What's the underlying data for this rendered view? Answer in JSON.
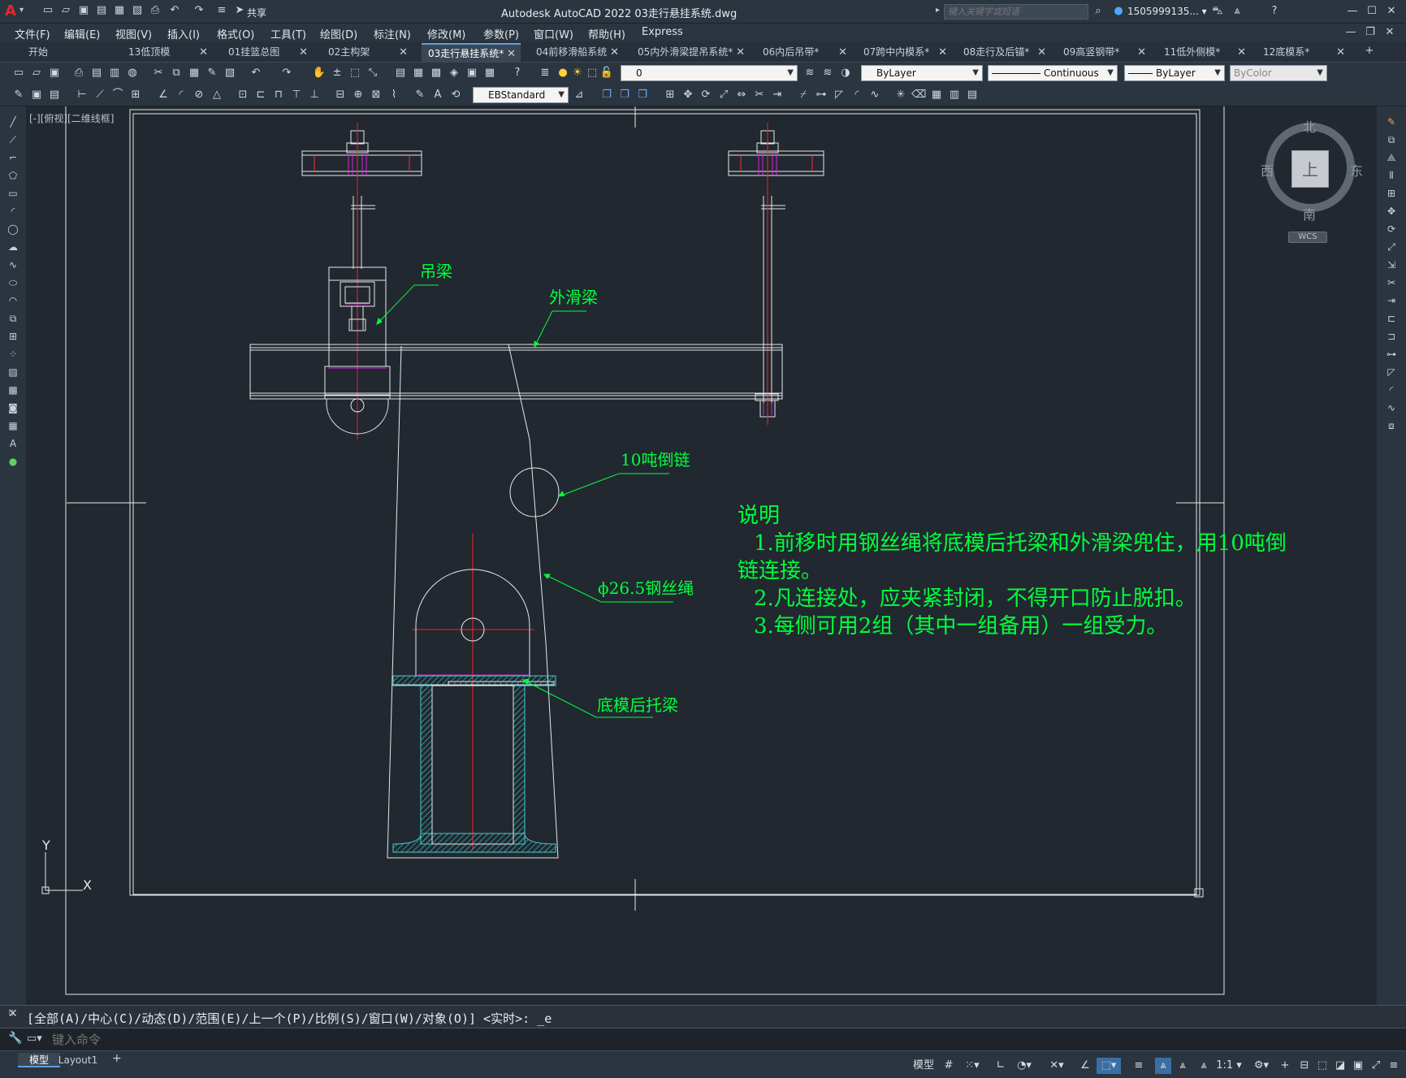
{
  "app": {
    "title": "Autodesk AutoCAD 2022    03走行悬挂系统.dwg",
    "share_label": "共享",
    "search_placeholder": "键入关键字或短语",
    "user": "1505999135... ▾",
    "logo": "A"
  },
  "menu": [
    "文件(F)",
    "编辑(E)",
    "视图(V)",
    "插入(I)",
    "格式(O)",
    "工具(T)",
    "绘图(D)",
    "标注(N)",
    "修改(M)",
    "参数(P)",
    "窗口(W)",
    "帮助(H)",
    "Express"
  ],
  "tabs": [
    {
      "label": "开始",
      "active": false
    },
    {
      "label": "13低顶模",
      "active": false
    },
    {
      "label": "01挂篮总图",
      "active": false
    },
    {
      "label": "02主构架",
      "active": false
    },
    {
      "label": "03走行悬挂系统*",
      "active": true
    },
    {
      "label": "04前移滑船系统",
      "active": false
    },
    {
      "label": "05内外滑梁提吊系统*",
      "active": false
    },
    {
      "label": "06内后吊带*",
      "active": false
    },
    {
      "label": "07跨中内模系*",
      "active": false
    },
    {
      "label": "08走行及后锚*",
      "active": false
    },
    {
      "label": "09高竖钢带*",
      "active": false
    },
    {
      "label": "11低外侧模*",
      "active": false
    },
    {
      "label": "12底模系*",
      "active": false
    }
  ],
  "properties": {
    "layer": "0",
    "color": "ByLayer",
    "linetype": "Continuous",
    "lineweight": "ByLayer",
    "plotstyle": "ByColor",
    "dimstyle": "EBStandard"
  },
  "viewport_label": "[-][俯视][二维线框]",
  "viewcube": {
    "north": "北",
    "south": "南",
    "east": "东",
    "west": "西",
    "face": "上",
    "wcs": "WCS"
  },
  "ucs": {
    "x": "X",
    "y": "Y"
  },
  "drawing": {
    "labels": {
      "hanger_beam": "吊梁",
      "outer_slide_beam": "外滑梁",
      "chain_hoist": "10吨倒链",
      "wire_rope": "ϕ26.5钢丝绳",
      "bottom_beam": "底模后托梁"
    },
    "notes": {
      "title": "说明",
      "line1a": "1.前移时用钢丝绳将底模后托梁和外滑梁兜住，用10吨倒",
      "line1b": "链连接。",
      "line2": "2.凡连接处，应夹紧封闭，不得开口防止脱扣。",
      "line3": "3.每侧可用2组（其中一组备用）一组受力。"
    }
  },
  "command": {
    "history": "[全部(A)/中心(C)/动态(D)/范围(E)/上一个(P)/比例(S)/窗口(W)/对象(O)] <实时>: _e",
    "placeholder": "键入命令"
  },
  "layout_tabs": [
    "模型",
    "Layout1"
  ],
  "status": {
    "model": "模型",
    "scale": "1:1 ▾"
  },
  "colors": {
    "drawing_green": "#00ff3c",
    "line_white": "#e8e8e8",
    "center_red": "#ff2020",
    "magenta": "#e020e0",
    "hatch_cyan": "#3ecfd0",
    "canvas_bg": "#212830"
  }
}
